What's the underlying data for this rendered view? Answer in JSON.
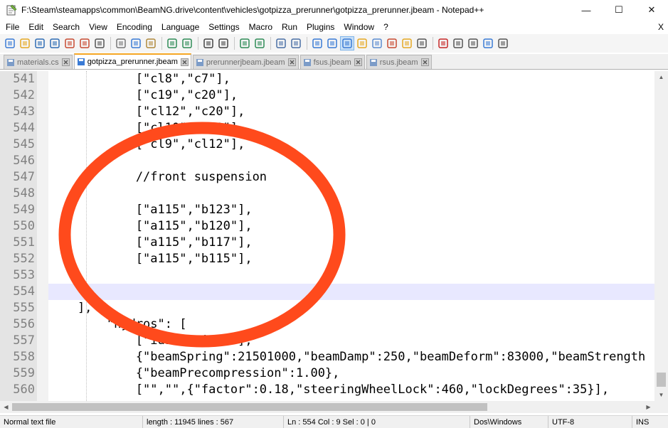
{
  "window": {
    "title": "F:\\Steam\\steamapps\\common\\BeamNG.drive\\content\\vehicles\\gotpizza_prerunner\\gotpizza_prerunner.jbeam - Notepad++",
    "minimize": "—",
    "maximize": "☐",
    "close": "✕"
  },
  "menu": {
    "items": [
      "File",
      "Edit",
      "Search",
      "View",
      "Encoding",
      "Language",
      "Settings",
      "Macro",
      "Run",
      "Plugins",
      "Window",
      "?"
    ],
    "close_doc": "X"
  },
  "toolbar": {
    "icons": [
      "new-file-icon",
      "open-file-icon",
      "save-icon",
      "save-all-icon",
      "close-icon",
      "close-all-icon",
      "print-icon",
      "cut-icon",
      "copy-icon",
      "paste-icon",
      "undo-icon",
      "redo-icon",
      "find-icon",
      "replace-icon",
      "zoom-in-icon",
      "zoom-out-icon",
      "sync-vertical-icon",
      "sync-horizontal-icon",
      "word-wrap-icon",
      "show-all-chars-icon",
      "indent-guide-icon",
      "user-language-icon",
      "document-map-icon",
      "function-list-icon",
      "folder-workspace-icon",
      "monitoring-icon",
      "record-macro-icon",
      "stop-record-icon",
      "play-macro-icon",
      "run-macro-multiple-icon",
      "save-macro-icon"
    ]
  },
  "tabs": [
    {
      "label": "materials.cs",
      "active": false
    },
    {
      "label": "gotpizza_prerunner.jbeam",
      "active": true
    },
    {
      "label": "prerunnerjbeam.jbeam",
      "active": false
    },
    {
      "label": "fsus.jbeam",
      "active": false
    },
    {
      "label": "rsus.jbeam",
      "active": false
    }
  ],
  "editor": {
    "current_line": "554",
    "lines": [
      {
        "num": "541",
        "text": "            [\"cl8\",\"c7\"],"
      },
      {
        "num": "542",
        "text": "            [\"c19\",\"c20\"],"
      },
      {
        "num": "543",
        "text": "            [\"cl12\",\"c20\"],"
      },
      {
        "num": "544",
        "text": "            [\"cl10\",\"cl9\"],"
      },
      {
        "num": "545",
        "text": "            [\"cl9\",\"cl12\"],"
      },
      {
        "num": "546",
        "text": ""
      },
      {
        "num": "547",
        "text": "            //front suspension"
      },
      {
        "num": "548",
        "text": ""
      },
      {
        "num": "549",
        "text": "            [\"a115\",\"b123\"],"
      },
      {
        "num": "550",
        "text": "            [\"a115\",\"b120\"],"
      },
      {
        "num": "551",
        "text": "            [\"a115\",\"b117\"],"
      },
      {
        "num": "552",
        "text": "            [\"a115\",\"b115\"],"
      },
      {
        "num": "553",
        "text": ""
      },
      {
        "num": "554",
        "text": ""
      },
      {
        "num": "555",
        "text": "    ],"
      },
      {
        "num": "556",
        "text": "        \"hydros\": ["
      },
      {
        "num": "557",
        "text": "            [\"id1:\",\"id2:\"],"
      },
      {
        "num": "558",
        "text": "            {\"beamSpring\":21501000,\"beamDamp\":250,\"beamDeform\":83000,\"beamStrength"
      },
      {
        "num": "559",
        "text": "            {\"beamPrecompression\":1.00},"
      },
      {
        "num": "560",
        "text": "            [\"\",\"\",{\"factor\":0.18,\"steeringWheelLock\":460,\"lockDegrees\":35}],"
      }
    ]
  },
  "status": {
    "file_type": "Normal text file",
    "length": "length : 11945    lines : 567",
    "position": "Ln : 554    Col : 9    Sel : 0 | 0",
    "eol": "Dos\\Windows",
    "encoding": "UTF-8",
    "mode": "INS"
  },
  "colors": {
    "annotation_circle": "#ff4a1c",
    "current_line": "#e8e8ff",
    "active_tab_accent": "#f5a623"
  }
}
